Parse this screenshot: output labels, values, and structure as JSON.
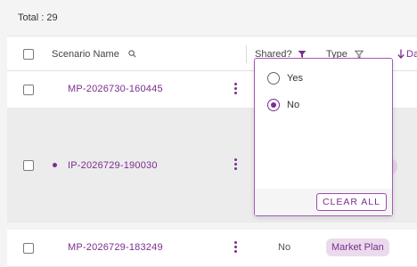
{
  "summary": {
    "total_text": "Total : 29"
  },
  "table": {
    "columns": {
      "scenario_name": "Scenario Name",
      "shared": "Shared?",
      "type": "Type",
      "date_partial": "Da"
    },
    "rows": [
      {
        "name": "MP-2026730-160445",
        "shared": "",
        "type": "",
        "selected": false
      },
      {
        "name": "IP-2026729-190030",
        "shared": "",
        "type": "",
        "selected": false
      },
      {
        "name": "MP-2026729-183249",
        "shared": "No",
        "type": "Market Plan",
        "selected": false
      }
    ]
  },
  "filter_dropdown": {
    "options": [
      {
        "label": "Yes",
        "checked": false
      },
      {
        "label": "No",
        "checked": true
      }
    ],
    "clear_label": "CLEAR ALL"
  },
  "icons": {
    "search": "search-icon",
    "filter_active": "filter-filled-icon",
    "filter": "filter-outline-icon",
    "sort": "arrow-down-icon",
    "row_menu": "more-vertical-icon"
  },
  "colors": {
    "accent": "#7b2d8e",
    "chip_bg": "#eadbec",
    "selected_row": "#ececec"
  }
}
